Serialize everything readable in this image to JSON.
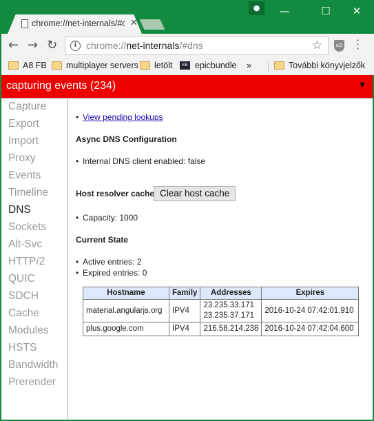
{
  "browser": {
    "tab_title": "chrome://net-internals/#dns",
    "url_prefix": "chrome://",
    "url_host": "net-internals",
    "url_path": "/#dns",
    "bookmarks": [
      "A8 FB",
      "multiplayer servers",
      "letölt",
      "epicbundle"
    ],
    "overflow": "»",
    "other_bookmarks": "További könyvjelzők"
  },
  "status_bar": {
    "text": "capturing events (234)",
    "color": "#ee0000"
  },
  "sidebar": {
    "items": [
      "Capture",
      "Export",
      "Import",
      "Proxy",
      "Events",
      "Timeline",
      "DNS",
      "Sockets",
      "Alt-Svc",
      "HTTP/2",
      "QUIC",
      "SDCH",
      "Cache",
      "Modules",
      "HSTS",
      "Bandwidth",
      "Prerender"
    ],
    "active": "DNS"
  },
  "dns": {
    "pending_link": "View pending lookups",
    "async_heading": "Async DNS Configuration",
    "internal_dns": "Internal DNS client enabled: false",
    "cache_heading": "Host resolver cache",
    "clear_button": "Clear host cache",
    "capacity": "Capacity: 1000",
    "state_heading": "Current State",
    "active_entries": "Active entries: 2",
    "expired_entries": "Expired entries: 0",
    "table": {
      "headers": [
        "Hostname",
        "Family",
        "Addresses",
        "Expires"
      ],
      "rows": [
        {
          "hostname": "material.angularjs.org",
          "family": "IPV4",
          "addresses": [
            "23.235.33.171",
            "23.235.37.171"
          ],
          "expires": "2016-10-24 07:42:01.910"
        },
        {
          "hostname": "plus.google.com",
          "family": "IPV4",
          "addresses": [
            "216.58.214.238"
          ],
          "expires": "2016-10-24 07:42:04.600"
        }
      ]
    }
  }
}
